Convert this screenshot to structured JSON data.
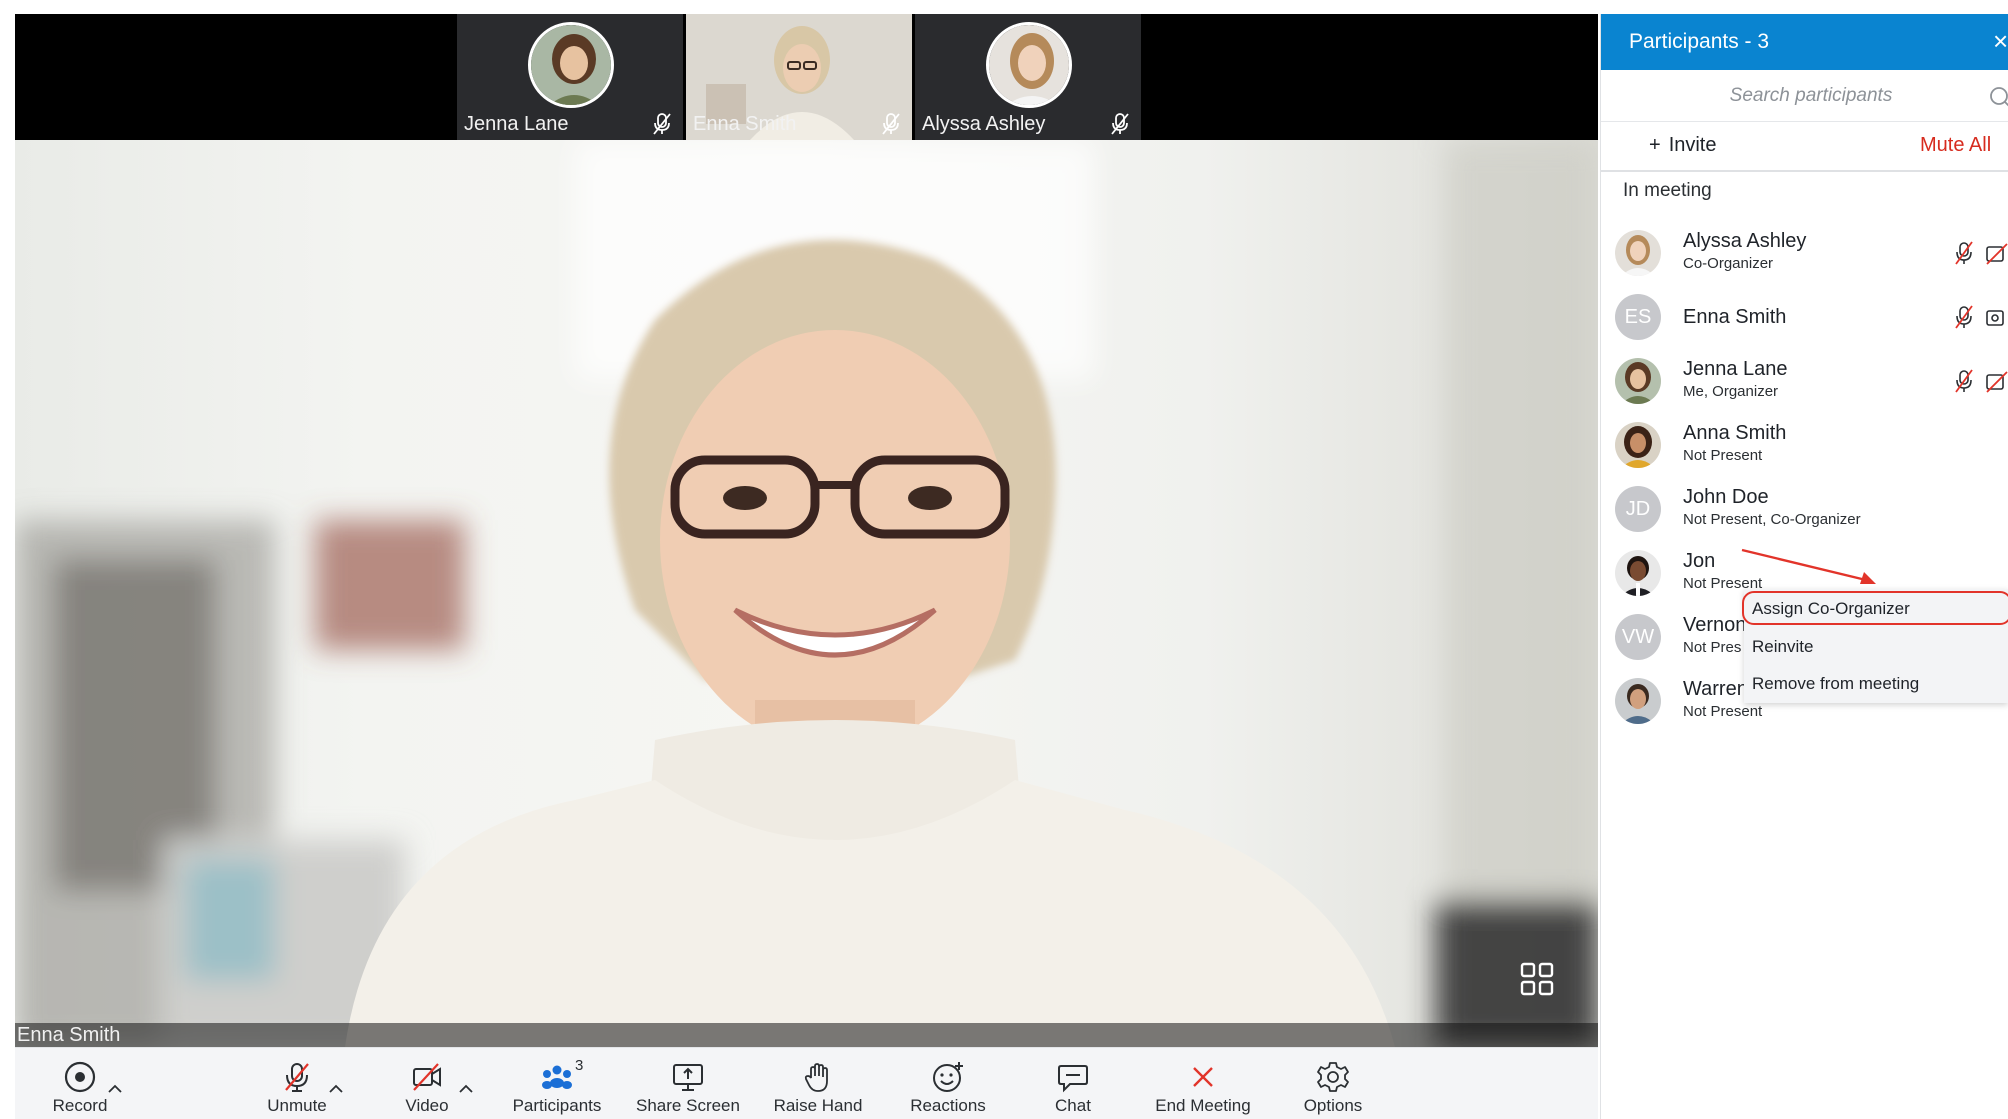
{
  "thumbnails": [
    {
      "name": "Jenna Lane",
      "muted_icon": "mic-muted-icon"
    },
    {
      "name": "Enna Smith",
      "muted_icon": "mic-muted-icon"
    },
    {
      "name": "Alyssa Ashley",
      "muted_icon": "mic-muted-icon"
    }
  ],
  "main_video": {
    "speaker_name": "Enna Smith"
  },
  "toolbar": {
    "record": "Record",
    "unmute": "Unmute",
    "video": "Video",
    "participants": "Participants",
    "participants_count": "3",
    "share_screen": "Share Screen",
    "raise_hand": "Raise Hand",
    "reactions": "Reactions",
    "chat": "Chat",
    "end_meeting": "End Meeting",
    "options": "Options"
  },
  "panel": {
    "title": "Participants - 3",
    "close": "×",
    "search_placeholder": "Search participants",
    "invite": "Invite",
    "invite_plus": "+",
    "mute_all": "Mute All",
    "section": "In meeting",
    "participants": [
      {
        "name": "Alyssa Ashley",
        "role": "Co-Organizer",
        "avatar": "photo"
      },
      {
        "name": "Enna Smith",
        "role": "",
        "avatar": "initials",
        "initials": "ES"
      },
      {
        "name": "Jenna Lane",
        "role": "Me, Organizer",
        "avatar": "photo"
      },
      {
        "name": "Anna Smith",
        "role": "Not Present",
        "avatar": "photo"
      },
      {
        "name": "John Doe",
        "role": "Not Present, Co-Organizer",
        "avatar": "initials",
        "initials": "JD"
      },
      {
        "name": "Jon",
        "role": "Not Present",
        "avatar": "photo"
      },
      {
        "name": "Vernon",
        "role": "Not Pres",
        "avatar": "initials",
        "initials": "VW"
      },
      {
        "name": "Warren",
        "role": "Not Present",
        "avatar": "photo"
      }
    ]
  },
  "context_menu": {
    "items": [
      "Assign Co-Organizer",
      "Reinvite",
      "Remove from meeting"
    ],
    "highlighted": "Assign Co-Organizer"
  },
  "colors": {
    "panel_header": "#0a84d0",
    "mute_all": "#d72c1f",
    "end_meeting": "#e2342a",
    "participants_icon": "#1b6fd6",
    "annotation": "#e2342a"
  }
}
